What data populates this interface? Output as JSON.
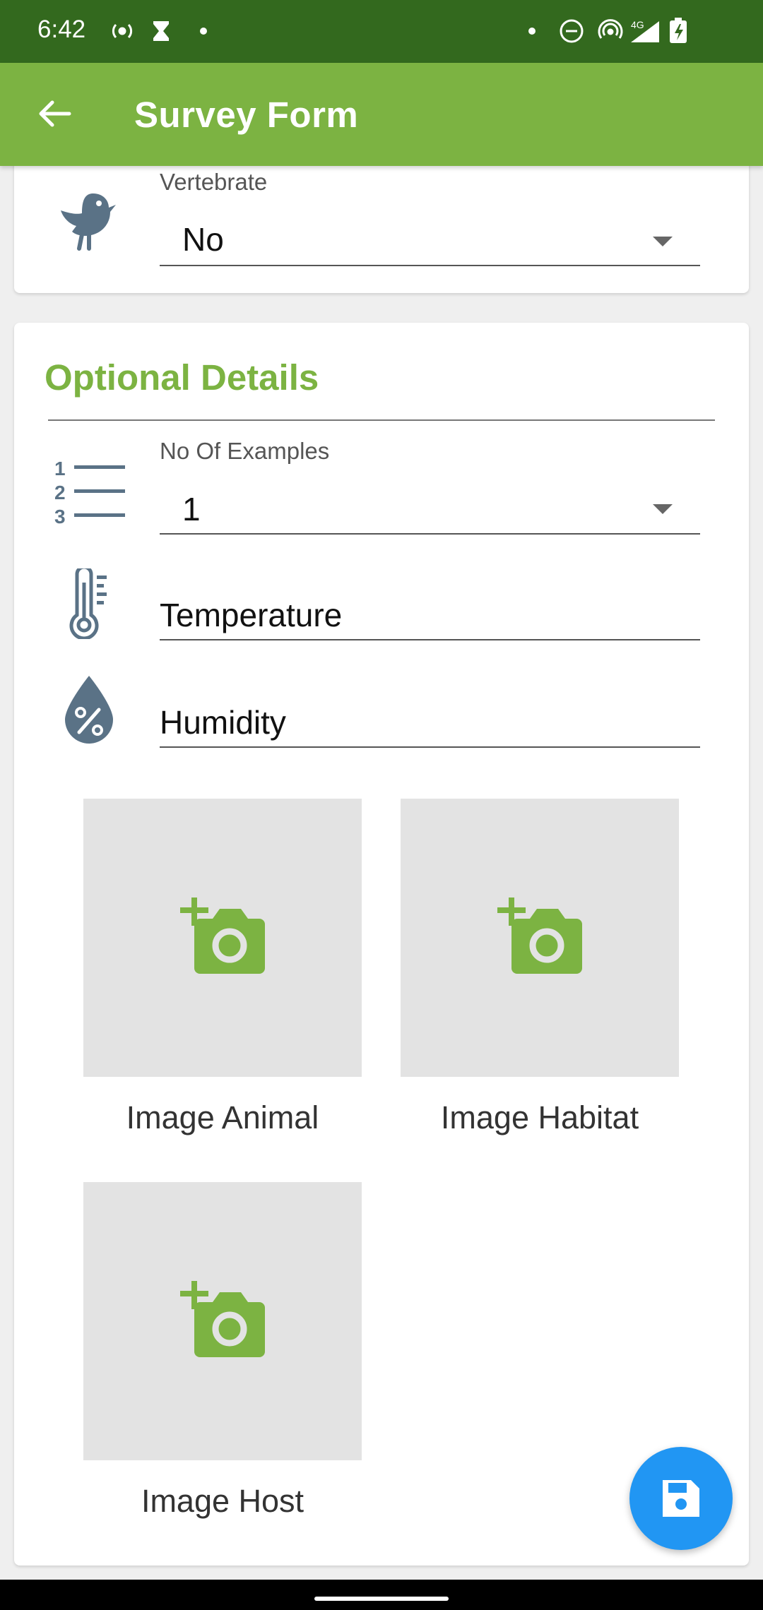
{
  "status_bar": {
    "time": "6:42",
    "network_label": "4G"
  },
  "app_bar": {
    "title": "Survey Form"
  },
  "vertebrate": {
    "label": "Vertebrate",
    "value": "No"
  },
  "optional_details": {
    "title": "Optional Details",
    "examples": {
      "label": "No Of Examples",
      "value": "1"
    },
    "temperature": {
      "placeholder": "Temperature"
    },
    "humidity": {
      "placeholder": "Humidity"
    },
    "images": [
      {
        "label": "Image Animal"
      },
      {
        "label": "Image Habitat"
      },
      {
        "label": "Image Host"
      }
    ]
  },
  "colors": {
    "status_bar": "#33691e",
    "app_bar": "#7cb342",
    "accent_green": "#7cb342",
    "icon_slate": "#5a7286",
    "fab": "#2196f3"
  }
}
